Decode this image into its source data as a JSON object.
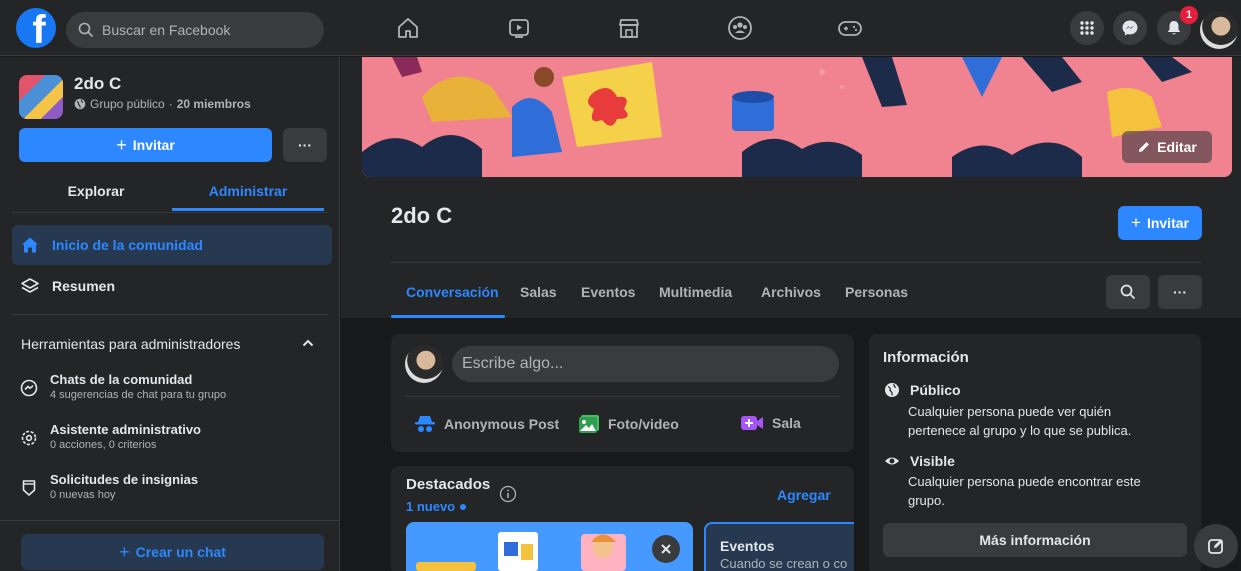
{
  "topbar": {
    "logo_letter": "f",
    "search_placeholder": "Buscar en Facebook",
    "notification_count": "1"
  },
  "sidebar": {
    "group_name": "2do C",
    "group_privacy": "Grupo público",
    "group_separator": " · ",
    "group_members": "20 miembros",
    "invite_label": "Invitar",
    "more_label": "···",
    "tabs": [
      "Explorar",
      "Administrar"
    ],
    "active_tab": "Administrar",
    "nav": [
      {
        "label": "Inicio de la comunidad"
      },
      {
        "label": "Resumen"
      }
    ],
    "tools_header": "Herramientas para administradores",
    "tools": [
      {
        "title": "Chats de la comunidad",
        "subtitle": "4 sugerencias de chat para tu grupo"
      },
      {
        "title": "Asistente administrativo",
        "subtitle": "0 acciones, 0 criterios"
      },
      {
        "title": "Solicitudes de insignias",
        "subtitle": "0 nuevas hoy"
      }
    ],
    "create_chat_label": "Crear un chat"
  },
  "main": {
    "edit_label": "Editar",
    "title": "2do C",
    "invite_label": "Invitar",
    "tabs": [
      "Conversación",
      "Salas",
      "Eventos",
      "Multimedia",
      "Archivos",
      "Personas"
    ],
    "more_label": "···",
    "composer": {
      "placeholder": "Escribe algo...",
      "actions": [
        "Anonymous Post",
        "Foto/video",
        "Sala"
      ]
    },
    "featured": {
      "title": "Destacados",
      "new_count": "1 nuevo",
      "add_label": "Agregar",
      "events_title": "Eventos",
      "events_text": "Cuando se crean o co"
    },
    "info": {
      "title": "Información",
      "public_title": "Público",
      "public_text": "Cualquier persona puede ver quién pertenece al grupo y lo que se publica.",
      "visible_title": "Visible",
      "visible_text": "Cualquier persona puede encontrar este grupo.",
      "more_info_label": "Más información"
    }
  },
  "colors": {
    "accent": "#2d88ff",
    "background": "#18191a",
    "surface": "#242526",
    "badge": "#e41e3f"
  }
}
